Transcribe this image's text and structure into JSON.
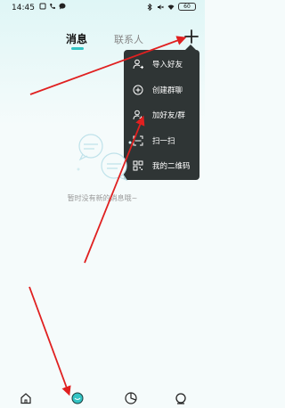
{
  "status_bar": {
    "time": "14:45",
    "battery": "60"
  },
  "tabs": [
    {
      "label": "消息",
      "active": true
    },
    {
      "label": "联系人",
      "active": false
    }
  ],
  "header": {
    "add_icon": "plus-icon"
  },
  "menu": {
    "items": [
      {
        "label": "导入好友",
        "icon": "import-contacts-icon"
      },
      {
        "label": "创建群聊",
        "icon": "create-group-icon"
      },
      {
        "label": "加好友/群",
        "icon": "add-friend-icon"
      },
      {
        "label": "扫一扫",
        "icon": "scan-icon"
      },
      {
        "label": "我的二维码",
        "icon": "qr-code-icon"
      }
    ]
  },
  "empty_state": {
    "text": "暂时没有新的消息哦~"
  },
  "bottom_nav": {
    "items": [
      {
        "icon": "home-icon"
      },
      {
        "icon": "messages-icon",
        "active": true
      },
      {
        "icon": "discover-icon"
      },
      {
        "icon": "profile-icon"
      }
    ]
  },
  "colors": {
    "accent": "#33c4c4",
    "menu_bg": "#2f3535",
    "annotation": "#e02020"
  }
}
